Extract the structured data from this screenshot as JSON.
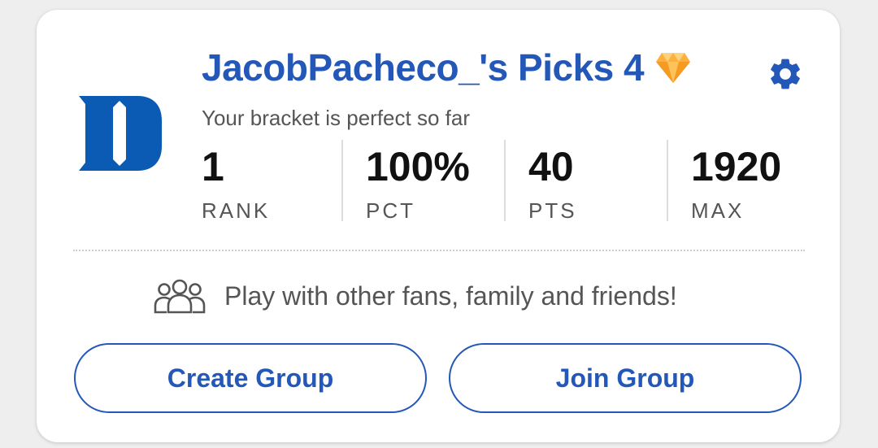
{
  "bracket": {
    "title": "JacobPacheco_'s Picks 4",
    "subtitle": "Your bracket is perfect so far",
    "badge_icon": "diamond-icon",
    "settings_icon": "gear-icon",
    "team_logo": "duke-d-logo"
  },
  "stats": [
    {
      "value": "1",
      "label": "RANK"
    },
    {
      "value": "100%",
      "label": "PCT"
    },
    {
      "value": "40",
      "label": "PTS"
    },
    {
      "value": "1920",
      "label": "MAX"
    }
  ],
  "promo": {
    "icon": "people-group-icon",
    "text": "Play with other fans, family and friends!"
  },
  "buttons": {
    "create_label": "Create Group",
    "join_label": "Join Group"
  },
  "colors": {
    "accent": "#2458b8",
    "logo_blue": "#0b5bb5",
    "text_dark": "#111111",
    "text_muted": "#555555"
  }
}
